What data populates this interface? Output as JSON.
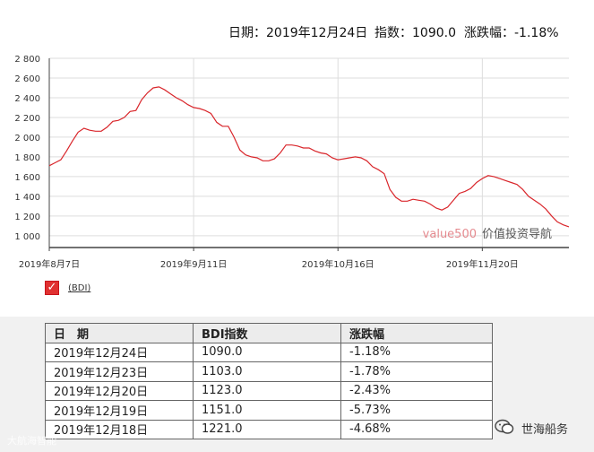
{
  "header": {
    "date_label": "日期：2019年12月24日",
    "index_label": "指数：1090.0",
    "change_label": "涨跌幅：-1.18%"
  },
  "chart_data": {
    "type": "line",
    "ylim": [
      880,
      2800
    ],
    "yticks": [
      1000,
      1200,
      1400,
      1600,
      1800,
      2000,
      2200,
      2400,
      2600,
      2800
    ],
    "ytick_labels": [
      "1 000",
      "1 200",
      "1 400",
      "1 600",
      "1 800",
      "2 000",
      "2 200",
      "2 400",
      "2 600",
      "2 800"
    ],
    "xticks": [
      {
        "label": "2019年8月7日",
        "index": 0
      },
      {
        "label": "2019年9月11日",
        "index": 25
      },
      {
        "label": "2019年10月16日",
        "index": 50
      },
      {
        "label": "2019年11月20日",
        "index": 75
      }
    ],
    "series": [
      {
        "name": "(BDI)",
        "color": "#d9262b",
        "values": [
          1710,
          1740,
          1770,
          1860,
          1960,
          2050,
          2090,
          2070,
          2060,
          2060,
          2100,
          2160,
          2170,
          2200,
          2260,
          2270,
          2380,
          2450,
          2500,
          2510,
          2480,
          2440,
          2400,
          2370,
          2330,
          2300,
          2290,
          2270,
          2240,
          2150,
          2110,
          2110,
          2000,
          1870,
          1820,
          1800,
          1790,
          1760,
          1760,
          1780,
          1840,
          1920,
          1920,
          1910,
          1890,
          1890,
          1860,
          1840,
          1830,
          1790,
          1770,
          1780,
          1790,
          1800,
          1790,
          1760,
          1700,
          1670,
          1630,
          1470,
          1390,
          1350,
          1350,
          1370,
          1360,
          1350,
          1320,
          1280,
          1260,
          1290,
          1360,
          1430,
          1450,
          1480,
          1540,
          1580,
          1610,
          1600,
          1580,
          1560,
          1540,
          1520,
          1470,
          1400,
          1360,
          1320,
          1270,
          1200,
          1140,
          1110,
          1090
        ]
      }
    ],
    "watermark": "value500 价值投资导航"
  },
  "legend": {
    "check": "✓",
    "label": "(BDI)"
  },
  "table": {
    "headers": [
      "日　期",
      "BDI指数",
      "涨跌幅"
    ],
    "rows": [
      [
        "2019年12月24日",
        "1090.0",
        "-1.18%"
      ],
      [
        "2019年12月23日",
        "1103.0",
        "-1.78%"
      ],
      [
        "2019年12月20日",
        "1123.0",
        "-2.43%"
      ],
      [
        "2019年12月19日",
        "1151.0",
        "-5.73%"
      ],
      [
        "2019年12月18日",
        "1221.0",
        "-4.68%"
      ]
    ]
  },
  "watermarks": {
    "left": "大航海智能",
    "right": "世海船务"
  }
}
